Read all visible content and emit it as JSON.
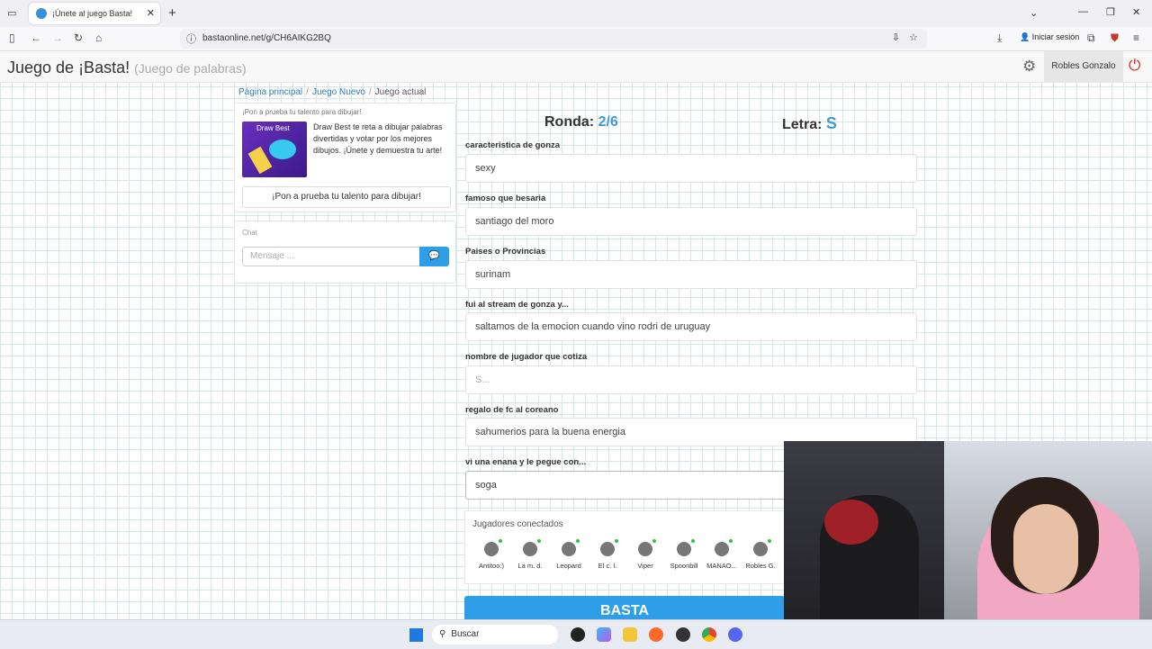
{
  "browser": {
    "tab_title": "¡Únete al juego Basta!",
    "url": "bastaonline.net/g/CH6AIKG2BQ",
    "signin_label": "Iniciar sesión"
  },
  "header": {
    "brand": "Juego de ¡Basta!",
    "brand_sub": "(Juego de palabras)",
    "user_name": "Robles Gonzalo"
  },
  "breadcrumb": {
    "home": "Página principal",
    "new_game": "Juego Nuevo",
    "current": "Juego actual"
  },
  "promo": {
    "heading": "¡Pon a prueba tu talento para dibujar!",
    "image_title": "Draw Best",
    "text": "Draw Best te reta a dibujar palabras divertidas y votar por los mejores dibujos. ¡Únete y demuestra tu arte!",
    "button": "¡Pon a prueba tu talento para dibujar!"
  },
  "chat": {
    "label": "Chat",
    "placeholder": "Mensaje ..."
  },
  "game": {
    "round_label": "Ronda:",
    "round_value": "2/6",
    "letter_label": "Letra:",
    "letter_value": "S",
    "categories": [
      {
        "label": "caracteristica de gonza",
        "value": "sexy"
      },
      {
        "label": "famoso que besaria",
        "value": "santiago del moro"
      },
      {
        "label": "Paises o Provincias",
        "value": "surinam"
      },
      {
        "label": "fui al stream de gonza y...",
        "value": "saltamos de la emocion cuando vino rodri de uruguay"
      },
      {
        "label": "nombre de jugador que cotiza",
        "value": "",
        "placeholder": "S..."
      },
      {
        "label": "regalo de fc al coreano",
        "value": "sahumerios para la buena energia"
      },
      {
        "label": "vi una enana y le pegue con...",
        "value": "soga"
      }
    ],
    "basta_button": "BASTA"
  },
  "players": {
    "heading": "Jugadores conectados",
    "list": [
      "Antitoo:)",
      "La m. d.",
      "Leopard",
      "El c. l.",
      "Viper",
      "Spoonbill",
      "MANAO...",
      "Robles G."
    ]
  },
  "taskbar": {
    "search_label": "Buscar"
  }
}
